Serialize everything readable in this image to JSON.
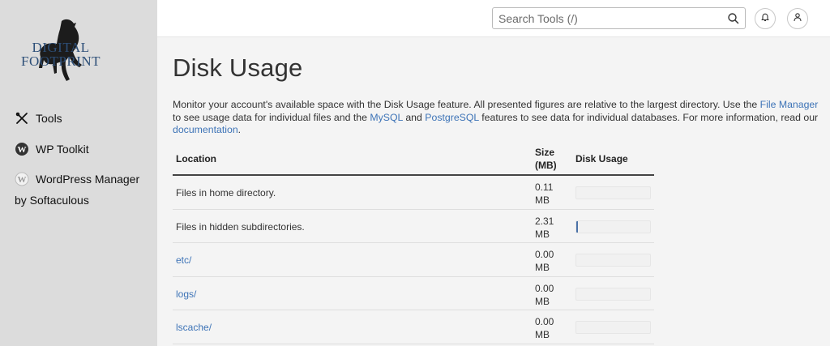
{
  "sidebar": {
    "logo": {
      "line1": "DIGITAL",
      "line2": "FOOTPRINT",
      "color": "#2d4f78"
    },
    "items": [
      {
        "label": "Tools",
        "icon": "tools-icon"
      },
      {
        "label": "WP Toolkit",
        "icon": "wordpress-icon"
      },
      {
        "label": "WordPress Manager",
        "label2": "by Softaculous",
        "icon": "wordpress-manager-icon"
      }
    ]
  },
  "header": {
    "search_placeholder": "Search Tools (/)",
    "icons": [
      "search-icon",
      "bell-icon",
      "user-icon"
    ]
  },
  "page": {
    "title": "Disk Usage",
    "description": {
      "t1": "Monitor your account's available space with the Disk Usage feature. All presented figures are relative to the largest directory. Use the ",
      "link_file_manager": "File Manager",
      "t2": " to see usage data for individual files and the ",
      "link_mysql": "MySQL",
      "t3": " and ",
      "link_postgresql": "PostgreSQL",
      "t4": " features to see data for individual databases. For more information, read our ",
      "link_documentation": "documentation",
      "t5": "."
    }
  },
  "table": {
    "headers": {
      "location": "Location",
      "size_line1": "Size",
      "size_line2": "(MB)",
      "disk_usage": "Disk Usage"
    },
    "rows": [
      {
        "location": "Files in home directory.",
        "size": "0.11",
        "unit": "MB",
        "usage_fraction": 0.0,
        "link": false
      },
      {
        "location": "Files in hidden subdirectories.",
        "size": "2.31",
        "unit": "MB",
        "usage_fraction": 0.02,
        "link": false
      },
      {
        "location": "etc/",
        "size": "0.00",
        "unit": "MB",
        "usage_fraction": 0.0,
        "link": true
      },
      {
        "location": "logs/",
        "size": "0.00",
        "unit": "MB",
        "usage_fraction": 0.0,
        "link": true
      },
      {
        "location": "lscache/",
        "size": "0.00",
        "unit": "MB",
        "usage_fraction": 0.0,
        "link": true
      }
    ]
  },
  "colors": {
    "link": "#3e74b7",
    "bar_fill": "#4a72a8",
    "sidebar_bg": "#dcdcdc"
  }
}
